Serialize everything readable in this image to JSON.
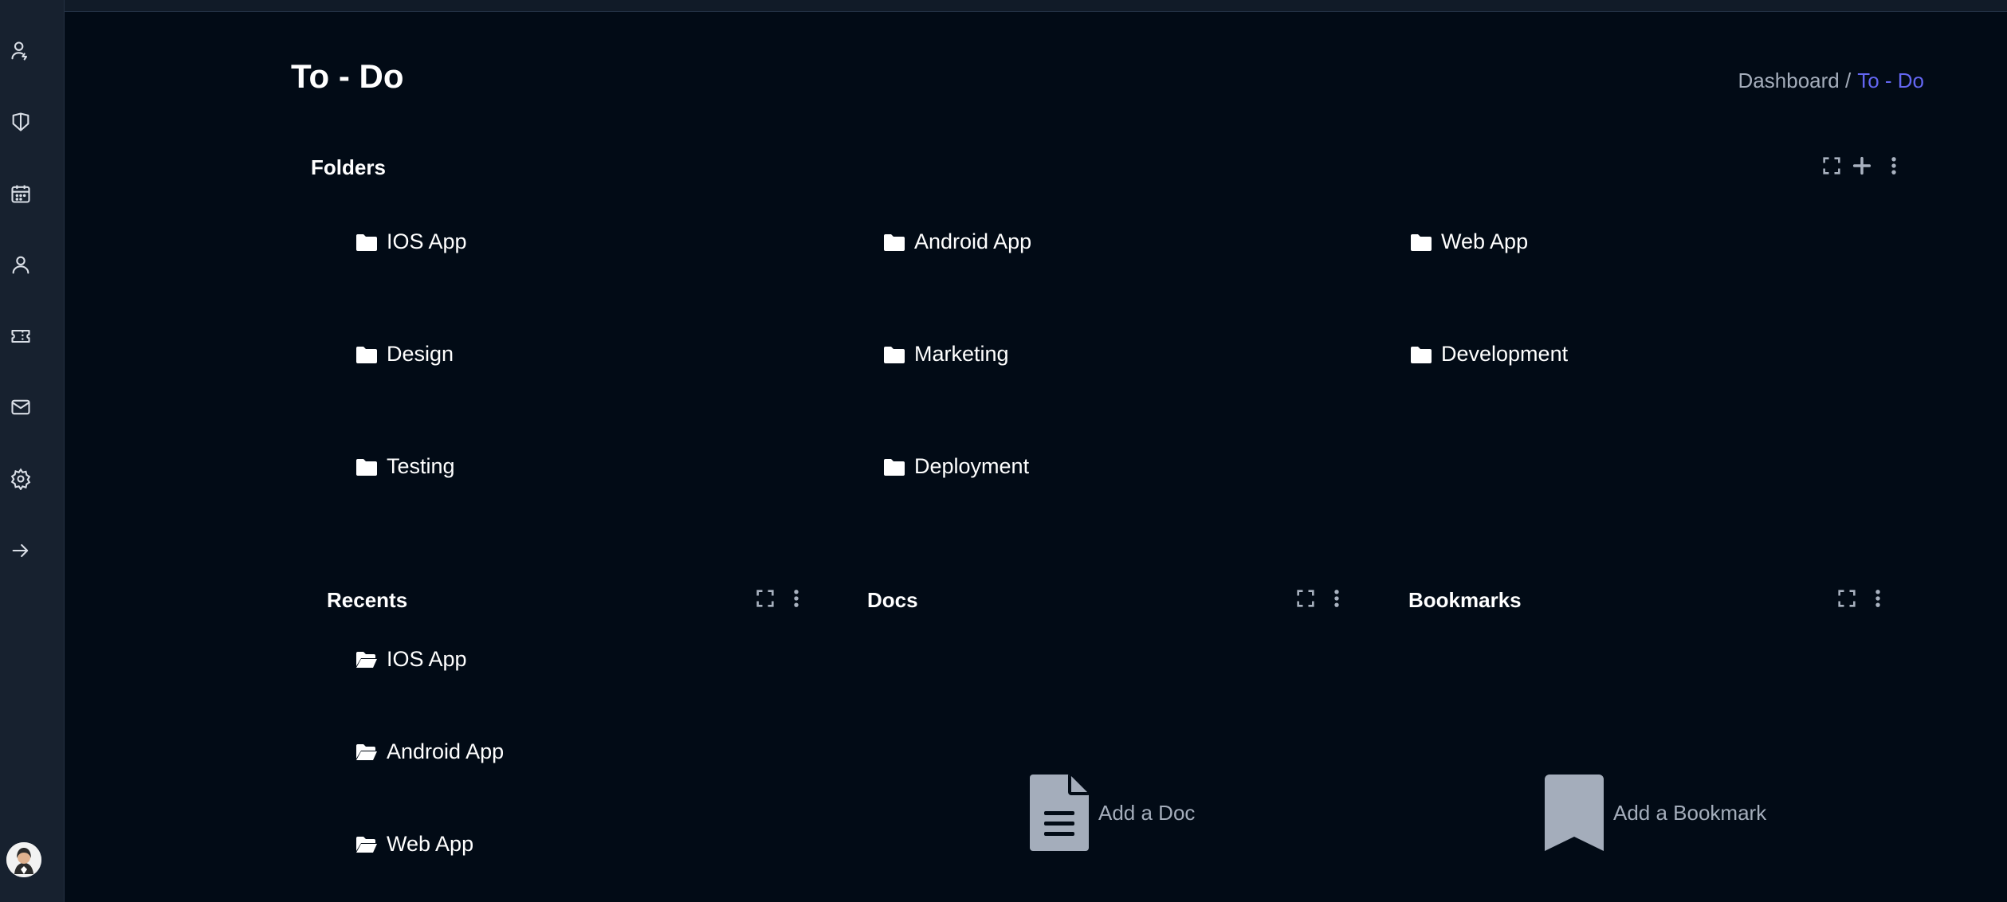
{
  "header": {
    "title": "To - Do",
    "breadcrumb_root": "Dashboard /",
    "breadcrumb_active": "To - Do"
  },
  "sidebar": {
    "icons": [
      "user-check-icon",
      "tag-icon",
      "calendar-icon",
      "user-icon",
      "ticket-icon",
      "mail-icon",
      "settings-icon",
      "arrow-right-icon"
    ],
    "avatar": "avatar"
  },
  "folders": {
    "title": "Folders",
    "items": [
      {
        "label": "IOS App"
      },
      {
        "label": "Android App"
      },
      {
        "label": "Web App"
      },
      {
        "label": "Design"
      },
      {
        "label": "Marketing"
      },
      {
        "label": "Development"
      },
      {
        "label": "Testing"
      },
      {
        "label": "Deployment"
      }
    ]
  },
  "recents": {
    "title": "Recents",
    "items": [
      {
        "label": "IOS App"
      },
      {
        "label": "Android App"
      },
      {
        "label": "Web App"
      }
    ]
  },
  "docs": {
    "title": "Docs",
    "add_label": "Add a Doc"
  },
  "bookmarks": {
    "title": "Bookmarks",
    "add_label": "Add a Bookmark"
  },
  "colors": {
    "background": "#020b16",
    "sidebar": "#17212f",
    "accent": "#6366f1",
    "muted_text": "#a4adbb"
  }
}
